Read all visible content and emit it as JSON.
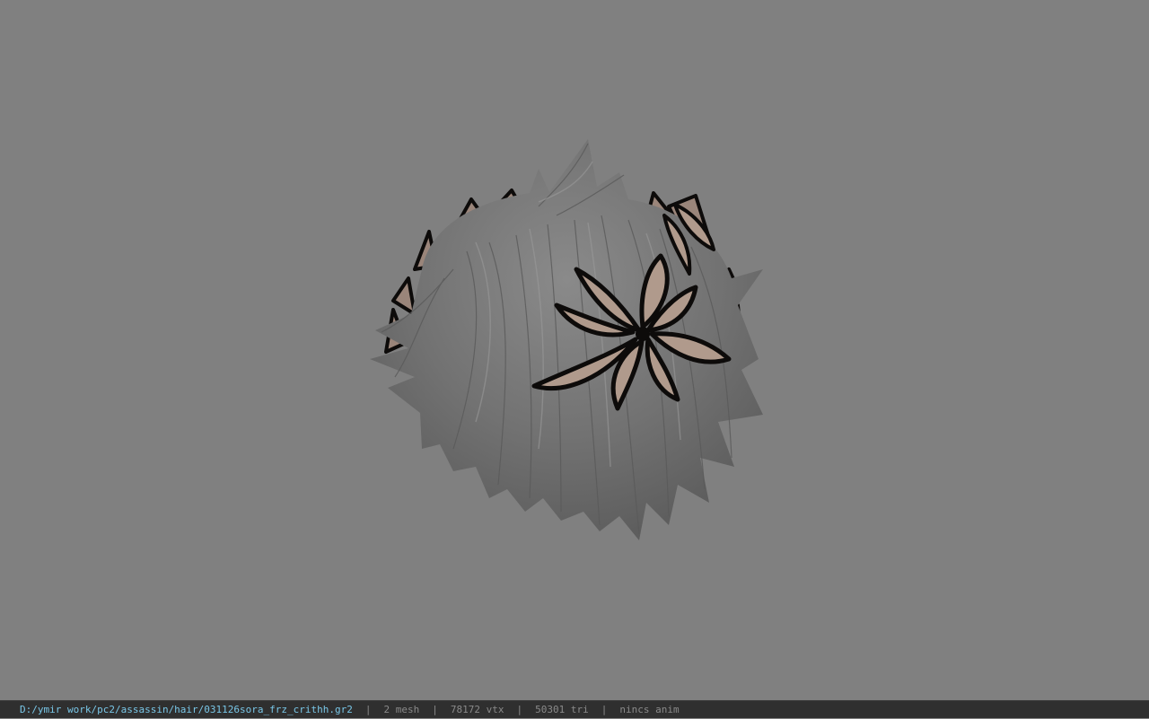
{
  "viewport": {
    "background_color": "#808080",
    "model": {
      "hair_color": "#6f6f6f",
      "hair_highlight": "#8c8c8c",
      "flower_fill": "#b09a8c",
      "flower_outline": "#0d0b0a"
    }
  },
  "statusbar": {
    "file_path": "D:/ymir work/pc2/assassin/hair/031126sora_frz_crithh.gr2",
    "separator": "|",
    "mesh_count": "2 mesh",
    "vertex_count": "78172 vtx",
    "triangle_count": "50301 tri",
    "anim_status": "nincs anim",
    "path_color": "#79c7e8",
    "text_color": "#8a8a8a"
  }
}
